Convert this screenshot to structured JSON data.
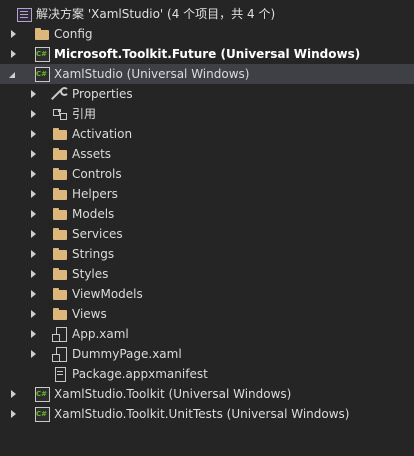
{
  "solution_explorer": {
    "solution_label": "解决方案 'XamlStudio' (4 个项目，共 4 个)",
    "items": [
      {
        "label": "Config",
        "icon": "folder-icon"
      },
      {
        "label": "Microsoft.Toolkit.Future (Universal Windows)",
        "icon": "csharp-project-icon"
      },
      {
        "label": "XamlStudio (Universal Windows)",
        "icon": "csharp-project-icon"
      },
      {
        "label": "Properties",
        "icon": "wrench-icon"
      },
      {
        "label": "引用",
        "icon": "references-icon"
      },
      {
        "label": "Activation",
        "icon": "folder-icon"
      },
      {
        "label": "Assets",
        "icon": "folder-icon"
      },
      {
        "label": "Controls",
        "icon": "folder-icon"
      },
      {
        "label": "Helpers",
        "icon": "folder-icon"
      },
      {
        "label": "Models",
        "icon": "folder-icon"
      },
      {
        "label": "Services",
        "icon": "folder-icon"
      },
      {
        "label": "Strings",
        "icon": "folder-icon"
      },
      {
        "label": "Styles",
        "icon": "folder-icon"
      },
      {
        "label": "ViewModels",
        "icon": "folder-icon"
      },
      {
        "label": "Views",
        "icon": "folder-icon"
      },
      {
        "label": "App.xaml",
        "icon": "xaml-file-icon"
      },
      {
        "label": "DummyPage.xaml",
        "icon": "xaml-file-icon"
      },
      {
        "label": "Package.appxmanifest",
        "icon": "manifest-file-icon"
      },
      {
        "label": "XamlStudio.Toolkit (Universal Windows)",
        "icon": "csharp-project-icon"
      },
      {
        "label": "XamlStudio.Toolkit.UnitTests (Universal Windows)",
        "icon": "csharp-project-icon"
      }
    ]
  },
  "colors": {
    "background": "#252526",
    "selected_row": "#3f3f46",
    "folder": "#dcb67a",
    "text": "#dcdcdc"
  }
}
